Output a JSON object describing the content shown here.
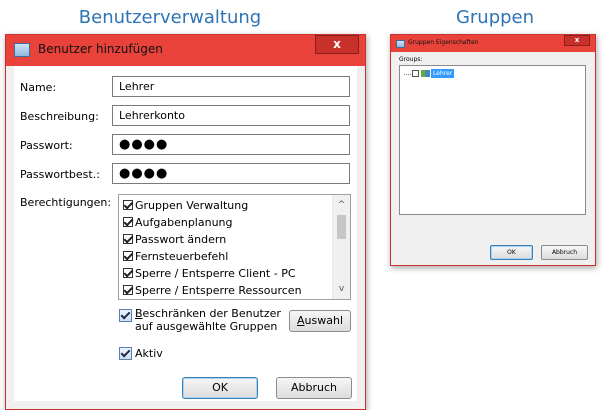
{
  "headings": {
    "left": "Benutzerverwaltung",
    "right": "Gruppen"
  },
  "user_dialog": {
    "title": "Benutzer hinzufügen",
    "close_glyph": "x",
    "labels": {
      "name": "Name:",
      "description": "Beschreibung:",
      "password": "Passwort:",
      "password_confirm": "Passwortbest.:",
      "permissions": "Berechtigungen:"
    },
    "values": {
      "name": "Lehrer",
      "description": "Lehrerkonto",
      "password": "●●●●",
      "password_confirm": "●●●●"
    },
    "permissions": [
      {
        "label": "Gruppen Verwaltung",
        "checked": true
      },
      {
        "label": "Aufgabenplanung",
        "checked": true
      },
      {
        "label": "Passwort ändern",
        "checked": true
      },
      {
        "label": "Fernsteuerbefehl",
        "checked": true
      },
      {
        "label": "Sperre / Entsperre Client - PC",
        "checked": true
      },
      {
        "label": "Sperre / Entsperre Ressourcen",
        "checked": true
      }
    ],
    "restrict": {
      "mnemonic": "B",
      "line1_rest": "eschränken der Benutzer",
      "line2": "auf ausgewählte Gruppen",
      "checked": true
    },
    "select_button": {
      "mnemonic": "A",
      "rest": "uswahl"
    },
    "active": {
      "label": "Aktiv",
      "checked": true
    },
    "ok_label": "OK",
    "cancel_label": "Abbruch",
    "scroll_up": "^",
    "scroll_down": "v"
  },
  "group_dialog": {
    "title": "Gruppen Eigenschaften",
    "close_glyph": "x",
    "groups_label": "Groups:",
    "tree": [
      {
        "label": "Lehrer",
        "checked": true,
        "selected": true
      }
    ],
    "ok_label": "OK",
    "cancel_label": "Abbruch"
  },
  "colors": {
    "titlebar": "#e9423a",
    "close_button": "#c7302b",
    "heading": "#2e74b5",
    "selection": "#3399ff"
  }
}
